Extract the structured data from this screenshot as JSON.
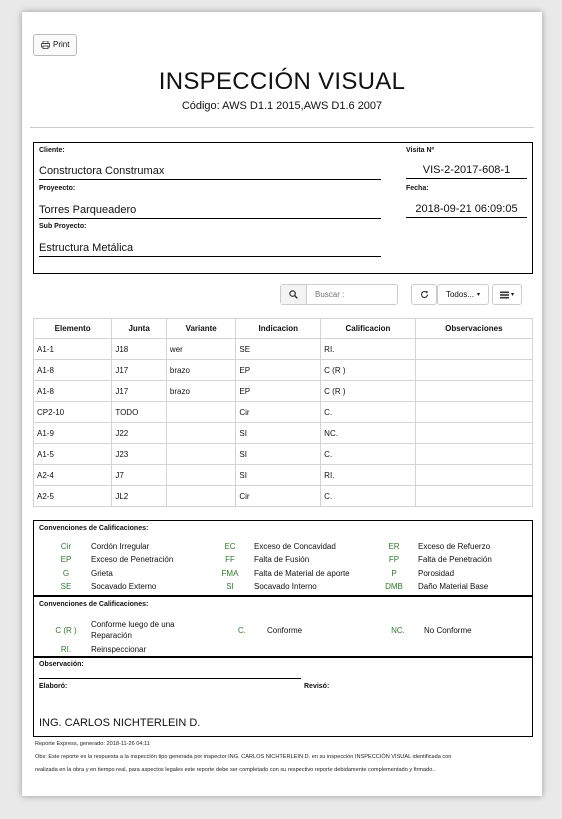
{
  "print_label": "Print",
  "title": "INSPECCIÓN VISUAL",
  "subtitle": "Código: AWS D1.1 2015,AWS D1.6 2007",
  "info": {
    "cliente_label": "Cliente:",
    "cliente": "Constructora Construmax",
    "proyecto_label": "Proyeecto:",
    "proyecto": "Torres Parqueadero",
    "subproyecto_label": "Sub Proyecto:",
    "subproyecto": "Estructura Metálica",
    "visita_label": "Visita Nº",
    "visita": "VIS-2-2017-608-1",
    "fecha_label": "Fecha:",
    "fecha": "2018-09-21 06:09:05"
  },
  "toolbar": {
    "search_placeholder": "Buscar :",
    "todos_label": "Todos..."
  },
  "table": {
    "headers": [
      "Elemento",
      "Junta",
      "Variante",
      "Indicacion",
      "Calificacion",
      "Observaciones"
    ],
    "rows": [
      [
        "A1-1",
        "J18",
        "wer",
        "SE",
        "RI.",
        ""
      ],
      [
        "A1-8",
        "J17",
        "brazo",
        "EP",
        "C (R )",
        ""
      ],
      [
        "A1-8",
        "J17",
        "brazo",
        "EP",
        "C (R )",
        ""
      ],
      [
        "CP2-10",
        "TODO",
        "",
        "Cir",
        "C.",
        ""
      ],
      [
        "A1-9",
        "J22",
        "",
        "SI",
        "NC.",
        ""
      ],
      [
        "A1-5",
        "J23",
        "",
        "SI",
        "C.",
        ""
      ],
      [
        "A2-4",
        "J7",
        "",
        "SI",
        "RI.",
        ""
      ],
      [
        "A2-5",
        "JL2",
        "",
        "Cir",
        "C.",
        ""
      ]
    ]
  },
  "conv1": {
    "title": "Convenciones de Calificaciones:",
    "items": [
      {
        "code": "Cir",
        "desc": "Cordón Irregular"
      },
      {
        "code": "EC",
        "desc": "Exceso de Concavidad"
      },
      {
        "code": "ER",
        "desc": "Exceso de Refuerzo"
      },
      {
        "code": "EP",
        "desc": "Exceso de Penetración"
      },
      {
        "code": "FF",
        "desc": "Falta de Fusión"
      },
      {
        "code": "FP",
        "desc": "Falta de Penetración"
      },
      {
        "code": "G",
        "desc": "Grieta"
      },
      {
        "code": "FMA",
        "desc": "Falta de Material de aporte"
      },
      {
        "code": "P",
        "desc": "Porosidad"
      },
      {
        "code": "SE",
        "desc": "Socavado Externo"
      },
      {
        "code": "SI",
        "desc": "Socavado Interno"
      },
      {
        "code": "DMB",
        "desc": "Daño Material Base"
      }
    ]
  },
  "conv2": {
    "title": "Convenciones de Calificaciones:",
    "items": [
      {
        "code": "C (R )",
        "desc": "Conforme luego de una Reparación"
      },
      {
        "code": "C.",
        "desc": "Conforme"
      },
      {
        "code": "NC.",
        "desc": "No Conforme"
      },
      {
        "code": "RI.",
        "desc": "Reinspeccionar"
      }
    ]
  },
  "obs": {
    "observacion_label": "Observación:",
    "elaboro_label": "Elaboró:",
    "reviso_label": "Revisó:",
    "elaboro_name": "ING. CARLOS NICHTERLEIN D."
  },
  "footer": {
    "generated": "Reporte Express, generado: 2018-11-26 04:11",
    "note_line1": "Obs: Este reporte es la respuesta a la inspección tipo generada por inspector ING. CARLOS NICHTERLEIN D. en su inspección INSPECCIÓN VISUAL identificada con",
    "note_line2": "realizada en la obra y en tiempo real, para aspectos legales este reporte debe ser completado con su respectivo reporte debidamente complementado y firmado.."
  }
}
